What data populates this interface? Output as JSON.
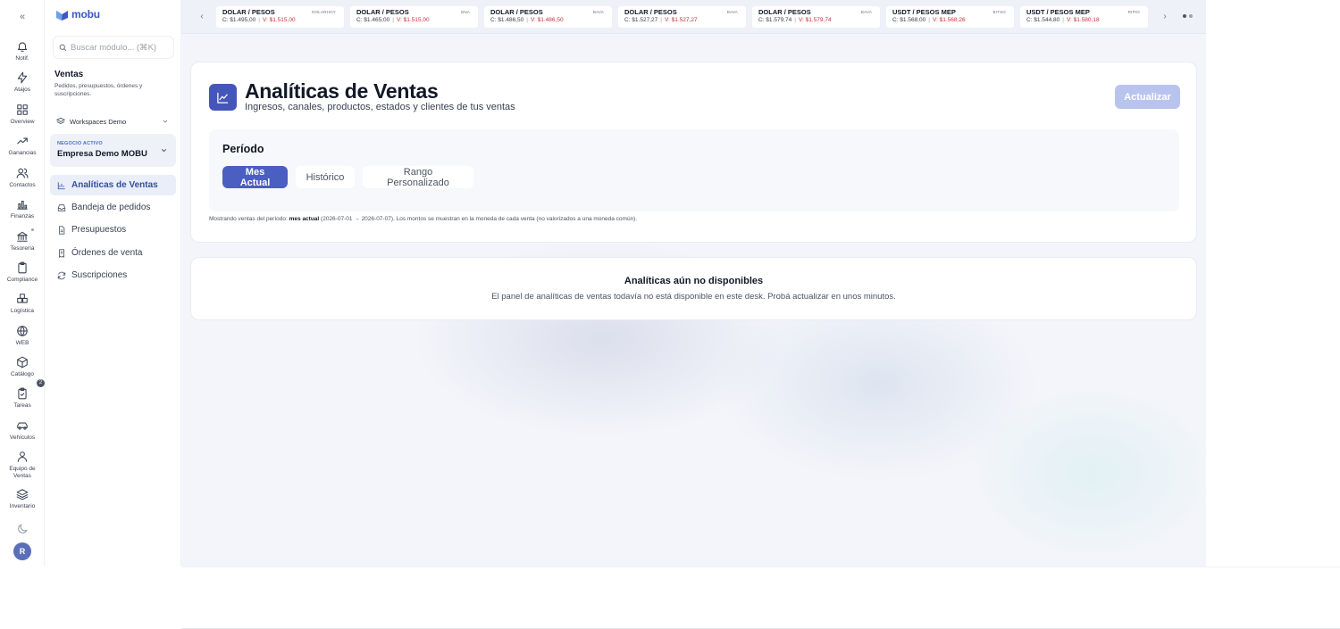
{
  "rail": {
    "items": [
      {
        "label": "Notif.",
        "icon": "bell-icon"
      },
      {
        "label": "Atajos",
        "icon": "lightning-icon"
      },
      {
        "label": "Overview",
        "icon": "grid-icon"
      },
      {
        "label": "Ganancias",
        "icon": "trending-up-icon"
      },
      {
        "label": "Contactos",
        "icon": "users-icon"
      },
      {
        "label": "Finanzas",
        "icon": "bar-chart-icon"
      },
      {
        "label": "Tesorería",
        "icon": "bank-icon"
      },
      {
        "label": "Compliance",
        "icon": "clipboard-icon"
      },
      {
        "label": "Logística",
        "icon": "boxes-icon"
      },
      {
        "label": "WEB",
        "icon": "globe-icon"
      },
      {
        "label": "Catálogo",
        "icon": "cube-icon"
      },
      {
        "label": "Tareas",
        "icon": "clipboard-check-icon"
      },
      {
        "label": "Vehículos",
        "icon": "car-icon"
      },
      {
        "label": "Equipo de Ventas",
        "icon": "team-icon"
      },
      {
        "label": "Inventario",
        "icon": "layers-icon"
      }
    ],
    "tasks_badge": "2",
    "avatar_initial": "R"
  },
  "sidebar": {
    "logo": "mobu",
    "search_placeholder": "Buscar módulo... (⌘K)",
    "section_title": "Ventas",
    "section_desc": "Pedidos, presupuestos, órdenes y suscripciones.",
    "workspace": "Workspaces Demo",
    "business_kicker": "NEGOCIO ACTIVO",
    "business_name": "Empresa Demo MOBU",
    "nav": [
      {
        "label": "Analíticas de Ventas",
        "icon": "chart-icon",
        "active": true
      },
      {
        "label": "Bandeja de pedidos",
        "icon": "inbox-icon",
        "active": false
      },
      {
        "label": "Presupuestos",
        "icon": "document-icon",
        "active": false
      },
      {
        "label": "Órdenes de venta",
        "icon": "receipt-icon",
        "active": false
      },
      {
        "label": "Suscripciones",
        "icon": "repeat-icon",
        "active": false
      }
    ]
  },
  "ticker": [
    {
      "pair": "DOLAR / PESOS",
      "source": "DOLARHOY",
      "compra": "C: $1.495,00",
      "venta": "V: $1.515,00"
    },
    {
      "pair": "DOLAR / PESOS",
      "source": "BNA",
      "compra": "C: $1.465,00",
      "venta": "V: $1.515,00"
    },
    {
      "pair": "DOLAR / PESOS",
      "source": "BAVA",
      "compra": "C: $1.486,50",
      "venta": "V: $1.486,50"
    },
    {
      "pair": "DOLAR / PESOS",
      "source": "BAVA",
      "compra": "C: $1.527,27",
      "venta": "V: $1.527,27"
    },
    {
      "pair": "DOLAR / PESOS",
      "source": "BAVA",
      "compra": "C: $1.579,74",
      "venta": "V: $1.579,74"
    },
    {
      "pair": "USDT / PESOS MEP",
      "source": "BITSO",
      "compra": "C: $1.568,00",
      "venta": "V: $1.568,26"
    },
    {
      "pair": "USDT / PESOS MEP",
      "source": "RIPIO",
      "compra": "C: $1.544,80",
      "venta": "V: $1.580,18"
    }
  ],
  "header": {
    "title": "Analíticas de Ventas",
    "subtitle": "Ingresos, canales, productos, estados y clientes de tus ventas",
    "refresh_label": "Actualizar",
    "period_title": "Período",
    "period_options": [
      {
        "label": "Mes Actual",
        "active": true
      },
      {
        "label": "Histórico",
        "active": false
      },
      {
        "label": "Rango Personalizado",
        "active": false
      }
    ],
    "note_prefix": "Mostrando ventas del período:",
    "note_bold": "mes actual",
    "note_suffix": "(2026-07-01 → 2026-07-07). Los montos se muestran en la moneda de cada venta (no valorizados a una moneda común)."
  },
  "empty": {
    "title": "Analíticas aún no disponibles",
    "desc": "El panel de analíticas de ventas todavía no está disponible en este desk. Probá actualizar en unos minutos."
  },
  "colors": {
    "accent": "#4b5ec2",
    "brand": "#3b57c4",
    "sell": "#c8323c"
  }
}
